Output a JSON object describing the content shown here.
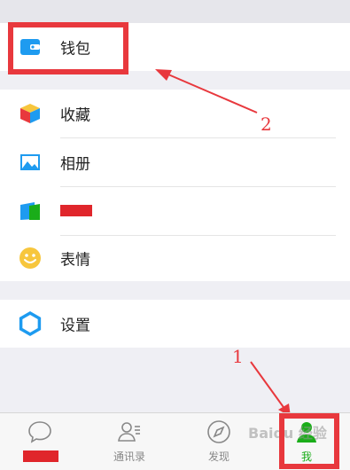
{
  "wallet": {
    "label": "钱包",
    "icon": "wallet-icon"
  },
  "menu": {
    "favorites": {
      "label": "收藏",
      "icon": "cube-icon"
    },
    "album": {
      "label": "相册",
      "icon": "photo-icon"
    },
    "cards": {
      "label": "",
      "icon": "card-icon"
    },
    "stickers": {
      "label": "表情",
      "icon": "smiley-icon"
    }
  },
  "settings": {
    "label": "设置",
    "icon": "gear-icon"
  },
  "tabbar": {
    "chats": {
      "label": "",
      "icon": "chat-bubble-icon"
    },
    "contacts": {
      "label": "通讯录",
      "icon": "contacts-icon"
    },
    "discover": {
      "label": "发现",
      "icon": "compass-icon"
    },
    "me": {
      "label": "我",
      "icon": "person-icon",
      "active": true
    }
  },
  "annotations": [
    {
      "number": "1",
      "target": "tab-me"
    },
    {
      "number": "2",
      "target": "wallet"
    }
  ],
  "watermark": "Baidu 经验",
  "colors": {
    "accent": "#1aad19",
    "annotation": "#e8383d",
    "icon_blue": "#1e9bf0"
  }
}
